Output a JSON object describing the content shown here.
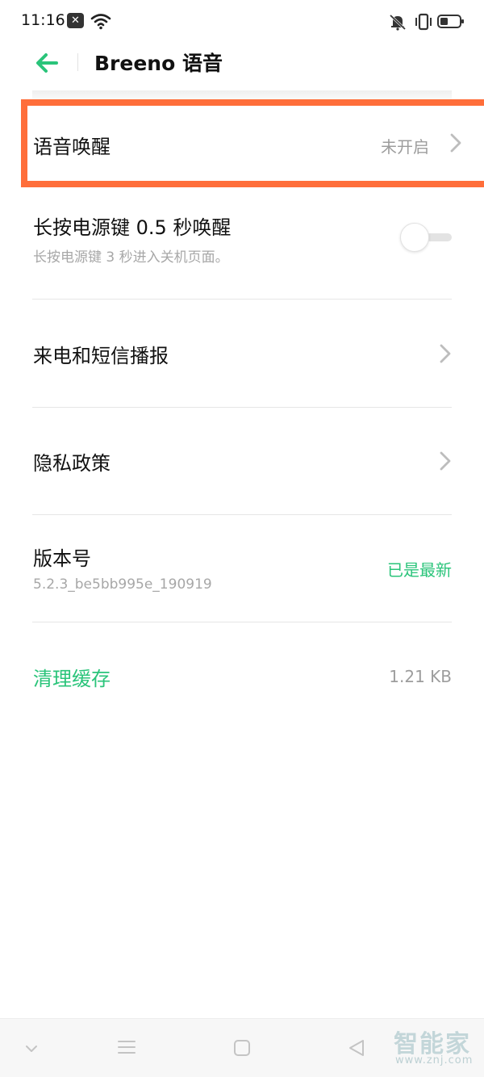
{
  "status_bar": {
    "time": "11:16",
    "notification_icon": "x-notification-icon",
    "wifi_icon": "wifi-icon",
    "mute_icon": "bell-muted-icon",
    "vibrate_icon": "vibrate-icon",
    "battery_icon": "battery-icon"
  },
  "app_bar": {
    "back_icon": "back-arrow-icon",
    "title": "Breeno 语音",
    "accent_color": "#2ac47a"
  },
  "settings": {
    "voice_wake": {
      "title": "语音唤醒",
      "value": "未开启"
    },
    "power_key_wake": {
      "title": "长按电源键 0.5 秒唤醒",
      "subtitle": "长按电源键 3 秒进入关机页面。",
      "toggle_on": false
    },
    "call_sms_broadcast": {
      "title": "来电和短信播报"
    },
    "privacy_policy": {
      "title": "隐私政策"
    },
    "version": {
      "title": "版本号",
      "subtitle": "5.2.3_be5bb995e_190919",
      "status": "已是最新"
    },
    "clear_cache": {
      "title": "清理缓存",
      "value": "1.21 KB"
    }
  },
  "highlight_color": "#ff6e3a",
  "nav_bar": {
    "collapse_icon": "chevron-down-icon",
    "menu_icon": "menu-icon",
    "home_icon": "square-home-icon",
    "back_icon": "triangle-back-icon"
  },
  "watermark": {
    "main": "智能家",
    "sub": "www.znj.com"
  }
}
